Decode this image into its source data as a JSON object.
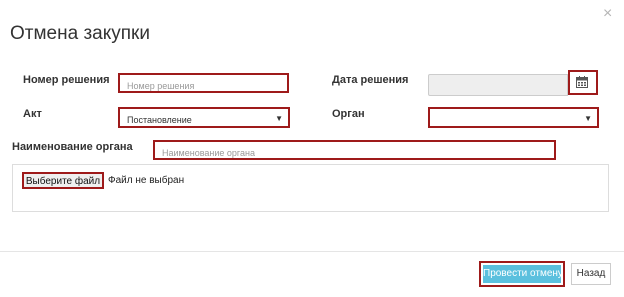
{
  "dialog": {
    "title": "Отмена закупки",
    "close_glyph": "×"
  },
  "form": {
    "decision_number": {
      "label": "Номер решения",
      "placeholder": "Номер решения",
      "value": ""
    },
    "decision_date": {
      "label": "Дата решения",
      "value": "",
      "icon": "calendar-icon"
    },
    "act": {
      "label": "Акт",
      "selected": "Постановление"
    },
    "organ": {
      "label": "Орган",
      "selected": ""
    },
    "organ_name": {
      "label": "Наименование органа",
      "placeholder": "Наименование органа",
      "value": ""
    },
    "file": {
      "button_label": "Выберите файл",
      "status": "Файл не выбран"
    }
  },
  "footer": {
    "submit_label": "Провести отмену",
    "back_label": "Назад"
  },
  "colors": {
    "highlight_border": "#9e1a1a",
    "primary_button": "#5bc0de",
    "disabled_field": "#eeeeee"
  }
}
